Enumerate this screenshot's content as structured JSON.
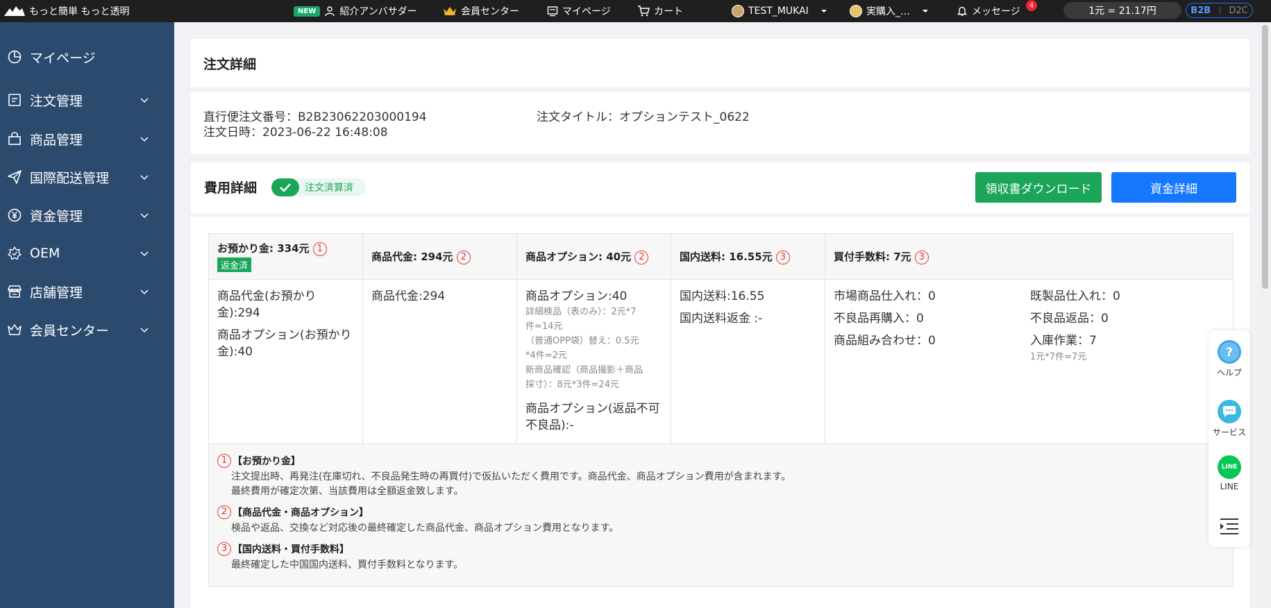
{
  "topbar": {
    "logo_text": "もっと簡単 もっと透明",
    "new_badge": "NEW",
    "ambassador": "紹介アンバサダー",
    "member_center": "会員センター",
    "mypage": "マイページ",
    "cart": "カート",
    "user": "TEST_MUKAI",
    "store": "実購入_…",
    "messages": "メッセージ",
    "message_count": "4",
    "rate": "1元 = 21.17円",
    "mode_b2b": "B2B",
    "mode_d2c": "D2C"
  },
  "sidebar": {
    "items": [
      {
        "label": "マイページ",
        "icon": "pie-chart-icon"
      },
      {
        "label": "注文管理",
        "icon": "order-icon"
      },
      {
        "label": "商品管理",
        "icon": "bag-icon"
      },
      {
        "label": "国際配送管理",
        "icon": "paper-plane-icon"
      },
      {
        "label": "資金管理",
        "icon": "yen-icon"
      },
      {
        "label": "OEM",
        "icon": "oem-icon"
      },
      {
        "label": "店舗管理",
        "icon": "store-icon"
      },
      {
        "label": "会員センター",
        "icon": "crown-icon"
      }
    ]
  },
  "order": {
    "page_title": "注文詳細",
    "number_label": "直行便注文番号：B2B23062203000194",
    "date_label": "注文日時：2023-06-22 16:48:08",
    "title_label": "注文タイトル：オプションテスト_0622"
  },
  "fees": {
    "title": "費用詳細",
    "status": "注文済算済",
    "download_button": "領収書ダウンロード",
    "funds_button": "資金詳細",
    "col1": {
      "header": "お預かり金: 334元",
      "num": "1",
      "tag": "返金済",
      "line1a": "商品代金(お預かり",
      "line1b": "金):294",
      "line2a": "商品オプション(お預かり",
      "line2b": "金):40"
    },
    "col2": {
      "header": "商品代金: 294元",
      "num": "2",
      "line1": "商品代金:294"
    },
    "col3": {
      "header": "商品オプション: 40元",
      "num": "2",
      "line1": "商品オプション:40",
      "d1": "詳細検品（表のみ）：2元*7",
      "d2": "件=14元",
      "d3": "（普通OPP袋）替え：0.5元",
      "d4": "*4件=2元",
      "d5": "新商品確認（商品撮影＋商品",
      "d6": "採寸）：8元*3件=24元",
      "line2a": "商品オプション(返品不可",
      "line2b": "不良品):-"
    },
    "col4": {
      "header": "国内送料: 16.55元",
      "num": "3",
      "line1": "国内送料:16.55",
      "line2": "国内送料返金 :-"
    },
    "col5": {
      "header": "買付手数料: 7元",
      "num": "3",
      "a1": "市場商品仕入れ：0",
      "a2": "不良品再購入：0",
      "a3": "商品組み合わせ：0",
      "b1": "既製品仕入れ：0",
      "b2": "不良品返品：0",
      "b3": "入庫作業：7",
      "b3_detail": "1元*7件=7元"
    },
    "notes": [
      {
        "num": "1",
        "title": "【お預かり金】",
        "lines": [
          "注文提出時、再発注(在庫切れ、不良品発生時の再買付)で仮払いただく費用です。商品代金、商品オプション費用が含まれます。",
          "最終費用が確定次第、当該費用は全額返金致します。"
        ]
      },
      {
        "num": "2",
        "title": "【商品代金・商品オプション】",
        "lines": [
          "検品や返品、交換など対応後の最終確定した商品代金、商品オプション費用となります。"
        ]
      },
      {
        "num": "3",
        "title": "【国内送料・買付手数料】",
        "lines": [
          "最終確定した中国国内送料、買付手数料となります。"
        ]
      }
    ]
  },
  "float_panel": {
    "help": "ヘルプ",
    "service": "サービス",
    "line": "LINE",
    "line_icon_text": "LINE"
  },
  "colors": {
    "sidebar_bg": "#2c4a6e",
    "topbar_bg": "#1f1f1f",
    "green": "#1aa559",
    "blue": "#1677ff",
    "red": "#e53935"
  }
}
